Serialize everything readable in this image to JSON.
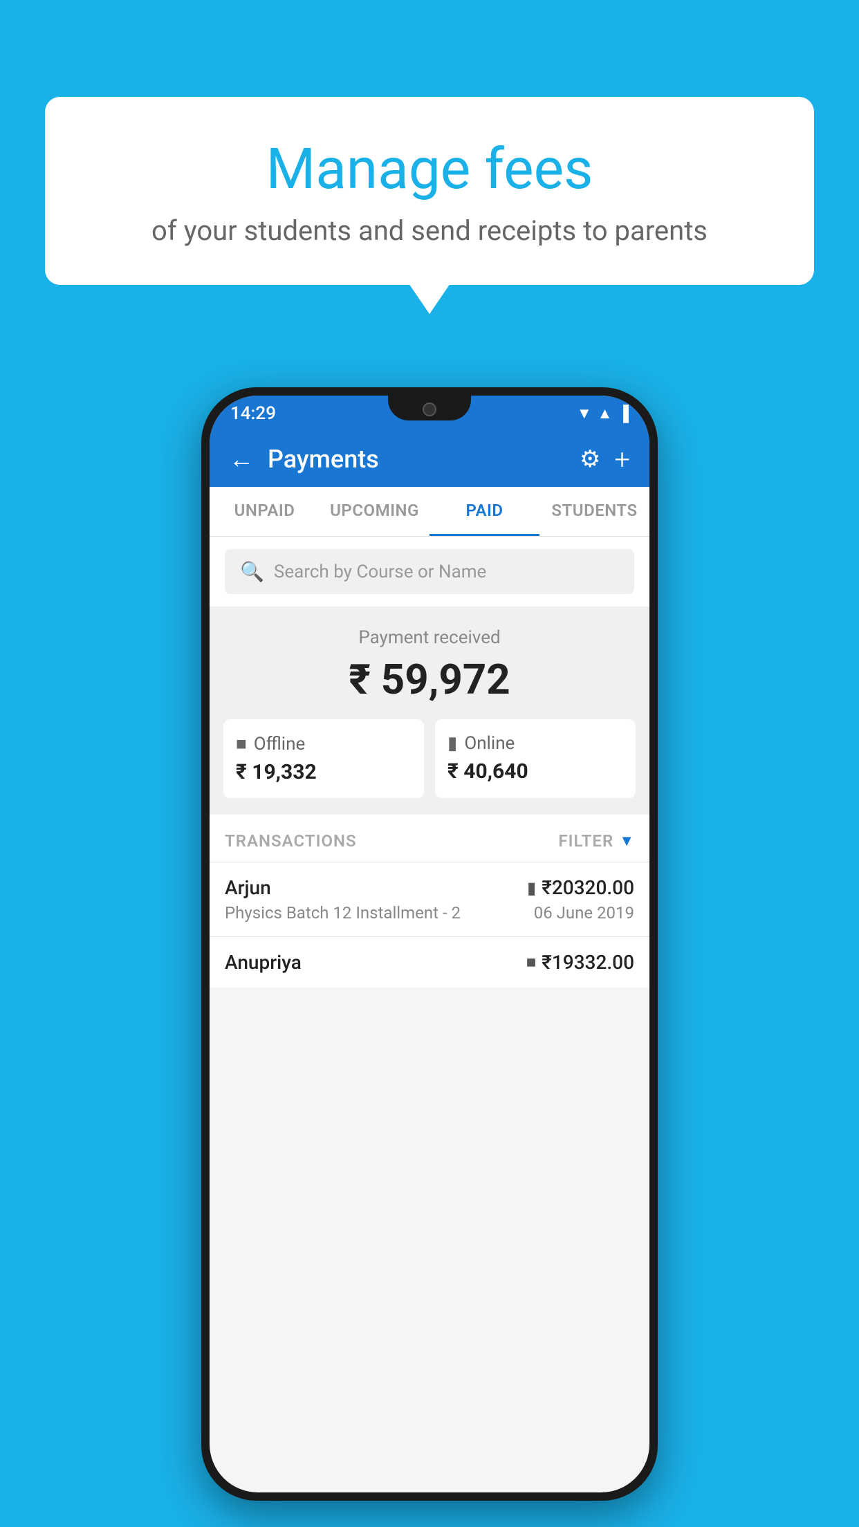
{
  "background_color": "#1AB0E8",
  "speech_bubble": {
    "title": "Manage fees",
    "subtitle": "of your students and send receipts to parents"
  },
  "phone": {
    "status_bar": {
      "time": "14:29",
      "wifi": "▼",
      "signal": "▲",
      "battery": "▌"
    },
    "header": {
      "back_label": "←",
      "title": "Payments",
      "gear_label": "⚙",
      "plus_label": "+"
    },
    "tabs": [
      {
        "label": "UNPAID",
        "active": false
      },
      {
        "label": "UPCOMING",
        "active": false
      },
      {
        "label": "PAID",
        "active": true
      },
      {
        "label": "STUDENTS",
        "active": false
      }
    ],
    "search": {
      "placeholder": "Search by Course or Name"
    },
    "payment_summary": {
      "label": "Payment received",
      "amount": "₹ 59,972",
      "offline_label": "Offline",
      "offline_amount": "₹ 19,332",
      "online_label": "Online",
      "online_amount": "₹ 40,640"
    },
    "transactions_section": {
      "label": "TRANSACTIONS",
      "filter_label": "FILTER"
    },
    "transactions": [
      {
        "name": "Arjun",
        "amount": "₹20320.00",
        "course": "Physics Batch 12 Installment - 2",
        "date": "06 June 2019",
        "mode": "card"
      },
      {
        "name": "Anupriya",
        "amount": "₹19332.00",
        "mode": "cash"
      }
    ]
  }
}
